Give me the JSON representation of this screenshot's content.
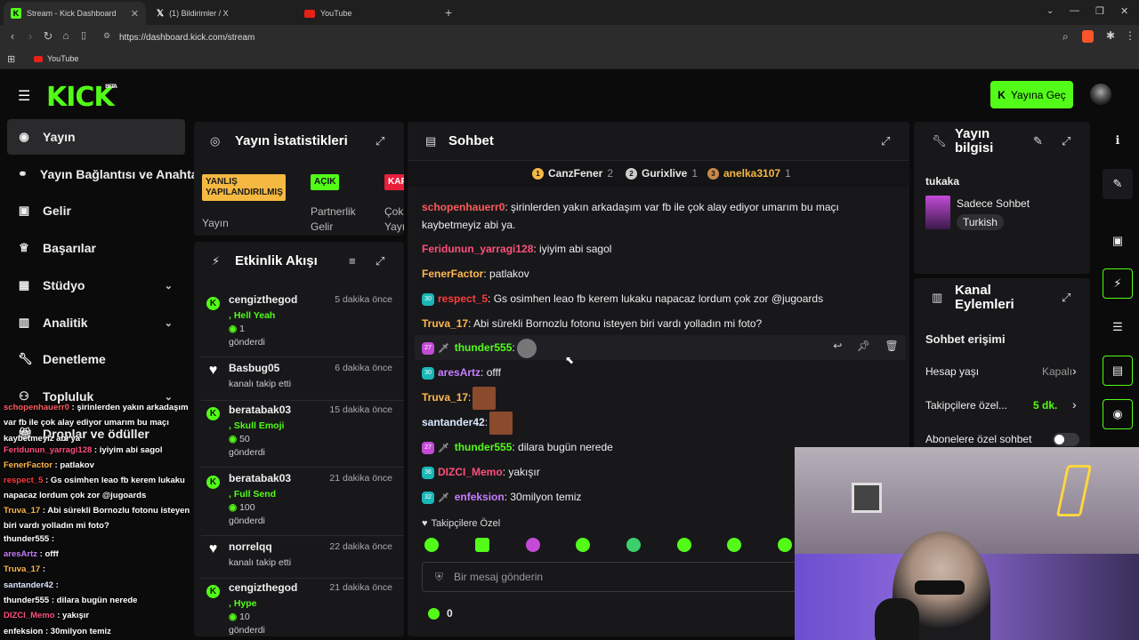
{
  "browser": {
    "tabs": [
      {
        "title": "Stream - Kick Dashboard"
      },
      {
        "title": "(1) Bildirimler / X"
      },
      {
        "title": "YouTube"
      }
    ],
    "url": "https://dashboard.kick.com/stream",
    "bookmark": "YouTube"
  },
  "header": {
    "logo": "KICK",
    "logo_sup": "BETA",
    "go_live": "Yayına Geç"
  },
  "nav": [
    {
      "label": "Yayın"
    },
    {
      "label": "Yayın Bağlantısı ve Anahta"
    },
    {
      "label": "Gelir"
    },
    {
      "label": "Başarılar"
    },
    {
      "label": "Stüdyo"
    },
    {
      "label": "Analitik"
    },
    {
      "label": "Denetleme"
    },
    {
      "label": "Topluluk"
    },
    {
      "label": "Droplar ve ödüller"
    }
  ],
  "overlay_chat": [
    {
      "user": "schopenhauerr0",
      "text": " : şirinlerden yakın arkadaşım var fb ile çok alay ediyor umarım bu maçı kaybetmeyiz abi ya"
    },
    {
      "user": "Feridunun_yarragi128",
      "text": " : iyiyim abi sagol"
    },
    {
      "user": "FenerFactor",
      "text": " : patlakov"
    },
    {
      "user": "respect_5",
      "text": " : Gs osimhen leao fb kerem lukaku napacaz lordum çok zor @jugoards"
    },
    {
      "user": "Truva_17",
      "text": " : Abi sürekli Bornozlu fotonu isteyen biri vardı yolladın mi foto?"
    },
    {
      "user": "thunder555",
      "text": " :"
    },
    {
      "user": "aresArtz",
      "text": " : offf"
    },
    {
      "user": "Truva_17",
      "text": " :"
    },
    {
      "user": "santander42",
      "text": " :"
    },
    {
      "user": "thunder555",
      "text": " : dilara bugün nerede"
    },
    {
      "user": "DIZCI_Memo",
      "text": " : yakışır"
    },
    {
      "user": "enfeksion",
      "text": " : 30milyon temiz"
    }
  ],
  "stats": {
    "title": "Yayın İstatistikleri",
    "items": [
      {
        "badge": "YANLIŞ YAPILANDIRILMIŞ",
        "label": "Yayın"
      },
      {
        "badge": "AÇIK",
        "label": "Partnerlik Gelir"
      },
      {
        "badge": "KAP",
        "label": "Çok Yayı"
      }
    ]
  },
  "activity": {
    "title": "Etkinlik Akışı",
    "items": [
      {
        "user": "cengizthegod",
        "time": "5 dakika önce",
        "line1": ", Hell Yeah",
        "amount": "1",
        "line3": "gönderdi"
      },
      {
        "user": "Basbug05",
        "time": "6 dakika önce",
        "line1": "kanalı takip etti"
      },
      {
        "user": "beratabak03",
        "time": "15 dakika önce",
        "line1": ", Skull Emoji",
        "amount": "50",
        "line3": "gönderdi"
      },
      {
        "user": "beratabak03",
        "time": "21 dakika önce",
        "line1": ", Full Send",
        "amount": "100",
        "line3": "gönderdi"
      },
      {
        "user": "norrelqq",
        "time": "22 dakika önce",
        "line1": "kanalı takip etti"
      },
      {
        "user": "cengizthegod",
        "time": "21 dakika önce",
        "line1": ", Hype",
        "amount": "10",
        "line3": "gönderdi"
      }
    ]
  },
  "chat": {
    "title": "Sohbet",
    "top": [
      {
        "rank": "1",
        "name": "CanzFener",
        "count": "2"
      },
      {
        "rank": "2",
        "name": "Gurixlive",
        "count": "1"
      },
      {
        "rank": "3",
        "name": "anelka3107",
        "count": "1"
      }
    ],
    "messages": [
      {
        "user": "schopenhauerr0",
        "text": ": şirinlerden yakın arkadaşım var fb ile çok alay ediyor umarım bu maçı kaybetmeyiz abi ya.",
        "color": "#ff5b5b"
      },
      {
        "user": "Feridunun_yarragi128",
        "text": ": iyiyim abi sagol",
        "color": "#ff4f7b"
      },
      {
        "user": "FenerFactor",
        "text": ": patlakov",
        "color": "#ffb84d"
      },
      {
        "user": "respect_5",
        "text": ": Gs osimhen leao fb kerem lukaku napacaz lordum çok zor @jugoards",
        "color": "#ff3b3b",
        "badge": "30"
      },
      {
        "user": "Truva_17",
        "text": ": Abi sürekli Bornozlu fotonu isteyen biri vardı yolladın mi foto?",
        "color": "#ffb84d"
      },
      {
        "user": "thunder555",
        "text": ":",
        "color": "#53fc18",
        "badge": "27"
      },
      {
        "user": "aresArtz",
        "text": ": offf",
        "color": "#c77dff",
        "badge": "30"
      },
      {
        "user": "Truva_17",
        "text": ":",
        "color": "#ffb84d"
      },
      {
        "user": "santander42",
        "text": ":",
        "color": "#d9e8ff"
      },
      {
        "user": "thunder555",
        "text": ": dilara bugün nerede",
        "color": "#53fc18",
        "badge": "27"
      },
      {
        "user": "DIZCI_Memo",
        "text": ": yakışır",
        "color": "#ff4f7b",
        "badge": "36"
      },
      {
        "user": "enfeksion",
        "text": ": 30milyon temiz",
        "color": "#c77dff",
        "badge": "32"
      }
    ],
    "followers_only": "Takipçilere Özel",
    "placeholder": "Bir mesaj gönderin",
    "points": "0"
  },
  "info": {
    "title": "Yayın bilgisi",
    "streamer": "tukaka",
    "category": "Sadece Sohbet",
    "language": "Turkish"
  },
  "actions": {
    "title": "Kanal Eylemleri",
    "section": "Sohbet erişimi",
    "rows": [
      {
        "label": "Hesap yaşı",
        "value": "Kapalı"
      },
      {
        "label": "Takipçilere özel...",
        "value": "5 dk."
      },
      {
        "label": "Abonelere özel sohbet",
        "value": ""
      }
    ]
  }
}
